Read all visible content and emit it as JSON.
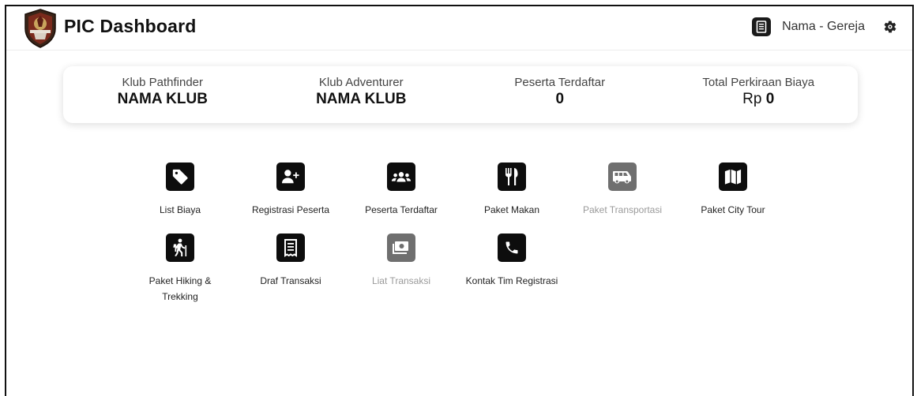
{
  "header": {
    "title": "PIC Dashboard",
    "user_name": "Nama - Gereja",
    "logo_icon": "club-emblem",
    "user_icon": "receipt-icon",
    "settings_icon": "gear-icon"
  },
  "summary": [
    {
      "label": "Klub Pathfinder",
      "value": "NAMA KLUB"
    },
    {
      "label": "Klub Adventurer",
      "value": "NAMA KLUB"
    },
    {
      "label": "Peserta Terdaftar",
      "value": "0"
    },
    {
      "label": "Total Perkiraan Biaya",
      "prefix": "Rp",
      "value": "0"
    }
  ],
  "menu": [
    {
      "label": "List Biaya",
      "icon": "tag-icon",
      "enabled": true
    },
    {
      "label": "Registrasi Peserta",
      "icon": "user-plus-icon",
      "enabled": true
    },
    {
      "label": "Peserta Terdaftar",
      "icon": "users-icon",
      "enabled": true
    },
    {
      "label": "Paket Makan",
      "icon": "utensils-icon",
      "enabled": true
    },
    {
      "label": "Paket Transportasi",
      "icon": "shuttle-van-icon",
      "enabled": false
    },
    {
      "label": "Paket City Tour",
      "icon": "map-icon",
      "enabled": true
    },
    {
      "label": "Paket Hiking & Trekking",
      "icon": "hiking-icon",
      "enabled": true
    },
    {
      "label": "Draf Transaksi",
      "icon": "receipt-icon",
      "enabled": true
    },
    {
      "label": "Liat Transaksi",
      "icon": "money-bill-icon",
      "enabled": false
    },
    {
      "label": "Kontak Tim Registrasi",
      "icon": "phone-icon",
      "enabled": true
    }
  ],
  "colors": {
    "icon_tile": "#0d0d0d",
    "icon_tile_disabled": "#6f6f6f",
    "label_disabled": "#9a9a9a"
  }
}
